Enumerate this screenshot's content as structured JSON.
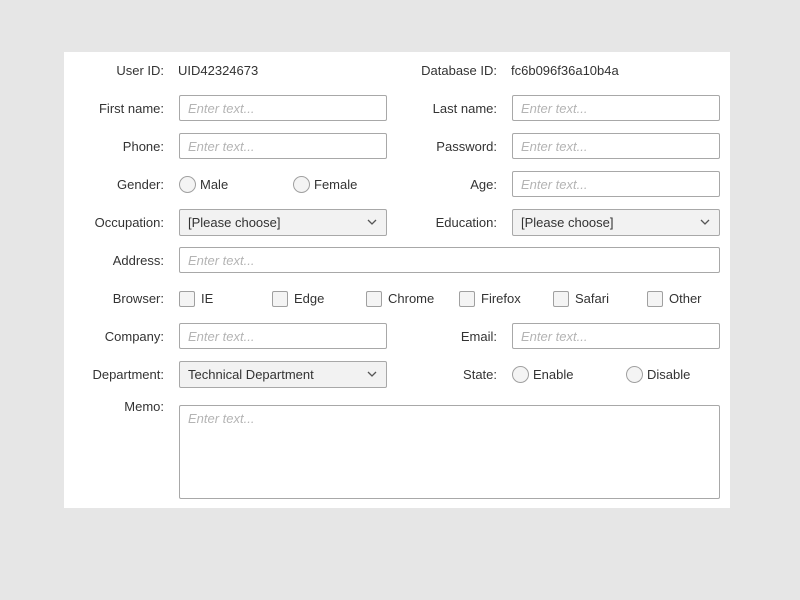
{
  "form": {
    "user_id": {
      "label": "User ID:",
      "value": "UID42324673"
    },
    "database_id": {
      "label": "Database ID:",
      "value": "fc6b096f36a10b4a"
    },
    "first_name": {
      "label": "First name:",
      "placeholder": "Enter text..."
    },
    "last_name": {
      "label": "Last name:",
      "placeholder": "Enter text..."
    },
    "phone": {
      "label": "Phone:",
      "placeholder": "Enter text..."
    },
    "password": {
      "label": "Password:",
      "placeholder": "Enter text..."
    },
    "gender": {
      "label": "Gender:",
      "options": [
        "Male",
        "Female"
      ]
    },
    "age": {
      "label": "Age:",
      "placeholder": "Enter text..."
    },
    "occupation": {
      "label": "Occupation:",
      "selected": "[Please choose]"
    },
    "education": {
      "label": "Education:",
      "selected": "[Please choose]"
    },
    "address": {
      "label": "Address:",
      "placeholder": "Enter text..."
    },
    "browser": {
      "label": "Browser:",
      "options": [
        "IE",
        "Edge",
        "Chrome",
        "Firefox",
        "Safari",
        "Other"
      ]
    },
    "company": {
      "label": "Company:",
      "placeholder": "Enter text..."
    },
    "email": {
      "label": "Email:",
      "placeholder": "Enter text..."
    },
    "department": {
      "label": "Department:",
      "selected": "Technical Department"
    },
    "state": {
      "label": "State:",
      "options": [
        "Enable",
        "Disable"
      ]
    },
    "memo": {
      "label": "Memo:",
      "placeholder": "Enter text..."
    }
  },
  "icons": {
    "dropdown": "chevron-down-icon",
    "radio": "radio-unchecked-icon",
    "checkbox": "checkbox-unchecked-icon"
  },
  "colors": {
    "background": "#e6e6e6",
    "panel": "#ffffff",
    "border": "#a8a8a8",
    "placeholder": "#b4b4b4",
    "select_fill": "#f2f2f2"
  }
}
